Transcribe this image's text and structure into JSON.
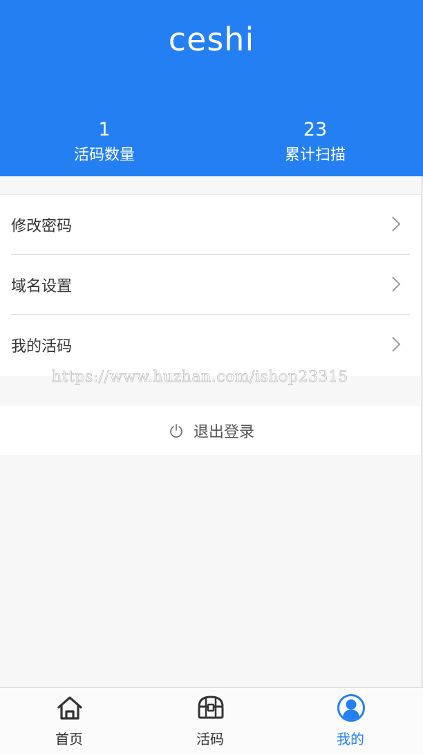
{
  "header": {
    "username": "ceshi",
    "stats": [
      {
        "value": "1",
        "label": "活码数量"
      },
      {
        "value": "23",
        "label": "累计扫描"
      }
    ]
  },
  "menu": {
    "items": [
      {
        "label": "修改密码",
        "icon": "chevron-right-icon"
      },
      {
        "label": "域名设置",
        "icon": "chevron-right-icon"
      },
      {
        "label": "我的活码",
        "icon": "chevron-right-icon"
      }
    ]
  },
  "watermark": "https://www.huzhan.com/ishop23315",
  "logout": {
    "label": "退出登录",
    "icon": "power-icon"
  },
  "tabbar": {
    "items": [
      {
        "label": "首页",
        "icon": "home-icon"
      },
      {
        "label": "活码",
        "icon": "treasure-box-icon"
      },
      {
        "label": "我的",
        "icon": "profile-icon",
        "active": true
      }
    ]
  },
  "colors": {
    "accent": "#2480f2",
    "background": "#f7f7f7"
  }
}
